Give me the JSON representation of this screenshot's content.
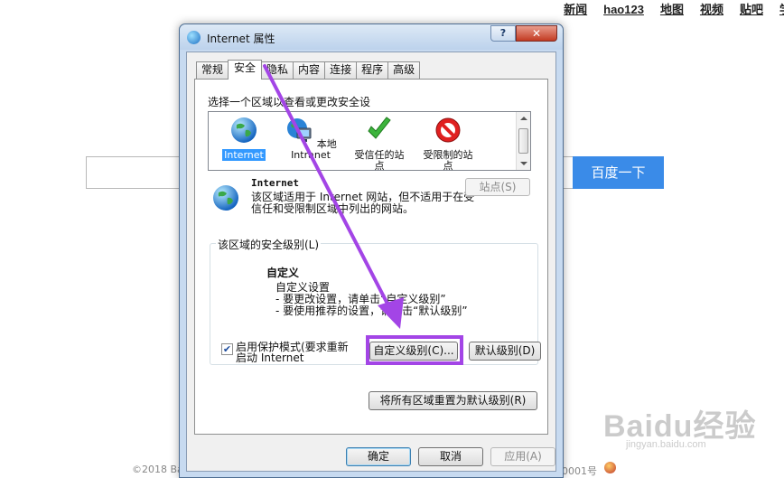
{
  "background": {
    "top_nav": [
      "新闻",
      "hao123",
      "地图",
      "视频",
      "贴吧",
      "学"
    ],
    "search_button_label": "百度一下",
    "footer_left": "©2018 Ba",
    "footer_right": "0001号",
    "watermark": "Baidu经验",
    "watermark_sub": "jingyan.baidu.com"
  },
  "dialog": {
    "title": "Internet 属性",
    "help_label": "?",
    "close_label": "✕",
    "tabs": [
      {
        "label": "常规",
        "active": false
      },
      {
        "label": "安全",
        "active": true
      },
      {
        "label": "隐私",
        "active": false
      },
      {
        "label": "内容",
        "active": false
      },
      {
        "label": "连接",
        "active": false
      },
      {
        "label": "程序",
        "active": false
      },
      {
        "label": "高级",
        "active": false
      }
    ],
    "zone_prompt": "选择一个区域以查看或更改安全设",
    "zones": [
      {
        "label": "Internet",
        "icon": "globe-icon",
        "selected": true
      },
      {
        "label": "本地\nIntranet",
        "icon": "intranet-icon",
        "selected": false
      },
      {
        "label": "受信任的站\n点",
        "icon": "check-icon",
        "selected": false
      },
      {
        "label": "受限制的站\n点",
        "icon": "restricted-icon",
        "selected": false
      }
    ],
    "zone_info": {
      "title": "Internet",
      "description": "该区域适用于 Internet 网站，但不适用于在受信任和受限制区域中列出的网站。",
      "sites_button": "站点(S)"
    },
    "security_level": {
      "legend": "该区域的安全级别(L)",
      "level_title": "自定义",
      "level_desc": "自定义设置\n- 要更改设置，请单击“自定义级别”\n- 要使用推荐的设置，请单击“默认级别”",
      "protected_mode_label": "启用保护模式(要求重新启动 Internet",
      "protected_mode_checked": true,
      "custom_level_button": "自定义级别(C)...",
      "default_level_button": "默认级别(D)"
    },
    "reset_all_button": "将所有区域重置为默认级别(R)",
    "ok_button": "确定",
    "cancel_button": "取消",
    "apply_button": "应用(A)"
  },
  "colors": {
    "highlight": "#a345e6",
    "arrow": "#a345e6",
    "baidu_blue": "#3a8be8",
    "selection": "#3399ff"
  }
}
